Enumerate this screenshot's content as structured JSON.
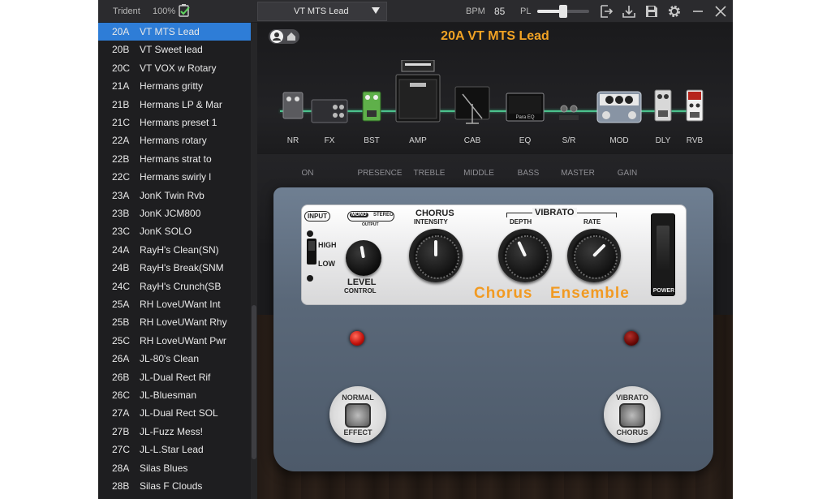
{
  "topbar": {
    "device_name": "Trident",
    "battery": "100%",
    "preset_dropdown": "VT MTS Lead",
    "bpm_label": "BPM",
    "bpm_value": "85",
    "pl_label": "PL",
    "pl_level": 0.5,
    "icons": [
      "export-icon",
      "download-icon",
      "save-icon",
      "gear-icon",
      "minimize-icon",
      "close-icon"
    ]
  },
  "presets": [
    {
      "num": "20A",
      "name": "VT MTS Lead",
      "selected": true
    },
    {
      "num": "20B",
      "name": "VT Sweet lead"
    },
    {
      "num": "20C",
      "name": "VT VOX w Rotary"
    },
    {
      "num": "21A",
      "name": "Hermans gritty"
    },
    {
      "num": "21B",
      "name": "Hermans LP & Mar"
    },
    {
      "num": "21C",
      "name": "Hermans preset 1"
    },
    {
      "num": "22A",
      "name": "Hermans rotary"
    },
    {
      "num": "22B",
      "name": "Hermans strat to"
    },
    {
      "num": "22C",
      "name": "Hermans swirly l"
    },
    {
      "num": "23A",
      "name": "JonK Twin Rvb"
    },
    {
      "num": "23B",
      "name": "JonK JCM800"
    },
    {
      "num": "23C",
      "name": "JonK SOLO"
    },
    {
      "num": "24A",
      "name": "RayH's Clean(SN)"
    },
    {
      "num": "24B",
      "name": "RayH's Break(SNM"
    },
    {
      "num": "24C",
      "name": "RayH's Crunch(SB"
    },
    {
      "num": "25A",
      "name": "RH LoveUWant Int"
    },
    {
      "num": "25B",
      "name": "RH LoveUWant Rhy"
    },
    {
      "num": "25C",
      "name": "RH LoveUWant Pwr"
    },
    {
      "num": "26A",
      "name": "JL-80's Clean"
    },
    {
      "num": "26B",
      "name": "JL-Dual Rect Rif"
    },
    {
      "num": "26C",
      "name": "JL-Bluesman"
    },
    {
      "num": "27A",
      "name": "JL-Dual Rect SOL"
    },
    {
      "num": "27B",
      "name": "JL-Fuzz Mess!"
    },
    {
      "num": "27C",
      "name": "JL-L.Star Lead"
    },
    {
      "num": "28A",
      "name": "Silas Blues"
    },
    {
      "num": "28B",
      "name": "Silas F Clouds"
    }
  ],
  "stage": {
    "title": "20A VT MTS Lead",
    "chain": [
      "NR",
      "FX",
      "BST",
      "AMP",
      "CAB",
      "EQ",
      "S/R",
      "MOD",
      "DLY",
      "RVB"
    ],
    "eq_module_text": "Para EQ",
    "amp_knobs": [
      "ON",
      "PRESENCE",
      "TREBLE",
      "MIDDLE",
      "BASS",
      "MASTER",
      "GAIN"
    ]
  },
  "pedal": {
    "input_label": "INPUT",
    "output_mono": "MONO",
    "output_stereo": "STEREO",
    "output_label": "OUTPUT",
    "high": "HIGH",
    "low": "LOW",
    "level_label": "LEVEL",
    "control_label": "CONTROL",
    "chorus_label": "CHORUS",
    "intensity_label": "INTENSITY",
    "vibrato_label": "VIBRATO",
    "depth_label": "DEPTH",
    "rate_label": "RATE",
    "power_label": "POWER",
    "name_part1": "Chorus",
    "name_part2": "Ensemble",
    "fs_left_top": "NORMAL",
    "fs_left_bottom": "EFFECT",
    "fs_right_top": "VIBRATO",
    "fs_right_bottom": "CHORUS",
    "accent_color": "#f19a22"
  }
}
